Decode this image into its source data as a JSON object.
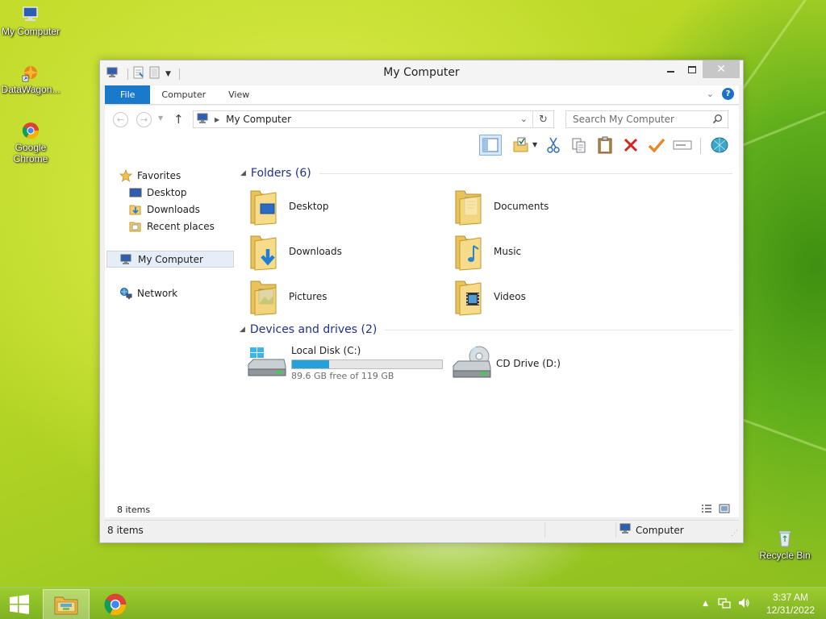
{
  "desktop": {
    "icons": [
      {
        "label": "My Computer"
      },
      {
        "label": "DataWagon..."
      },
      {
        "label": "Google Chrome"
      },
      {
        "label": "Recycle Bin"
      }
    ]
  },
  "window": {
    "title": "My Computer",
    "ribbon_tabs": [
      "File",
      "Computer",
      "View"
    ],
    "address": {
      "path": "My Computer",
      "search_placeholder": "Search My Computer"
    },
    "nav": {
      "favorites": "Favorites",
      "desktop": "Desktop",
      "downloads": "Downloads",
      "recent": "Recent places",
      "my_computer": "My Computer",
      "network": "Network"
    },
    "folders_header": "Folders (6)",
    "folders": [
      {
        "label": "Desktop"
      },
      {
        "label": "Documents"
      },
      {
        "label": "Downloads"
      },
      {
        "label": "Music"
      },
      {
        "label": "Pictures"
      },
      {
        "label": "Videos"
      }
    ],
    "drives_header": "Devices and drives (2)",
    "drives": {
      "c": {
        "label": "Local Disk (C:)",
        "free_text": "89.6 GB free of 119 GB",
        "used_fraction": 0.247
      },
      "d": {
        "label": "CD Drive (D:)"
      }
    },
    "items_count": "8 items",
    "status": {
      "left": "8 items",
      "right": "Computer"
    }
  },
  "taskbar": {
    "time": "3:37 AM",
    "date": "12/31/2022"
  },
  "colors": {
    "accent": "#1979ca",
    "drive_fill": "#26a0da",
    "group_header": "#1e3287"
  }
}
